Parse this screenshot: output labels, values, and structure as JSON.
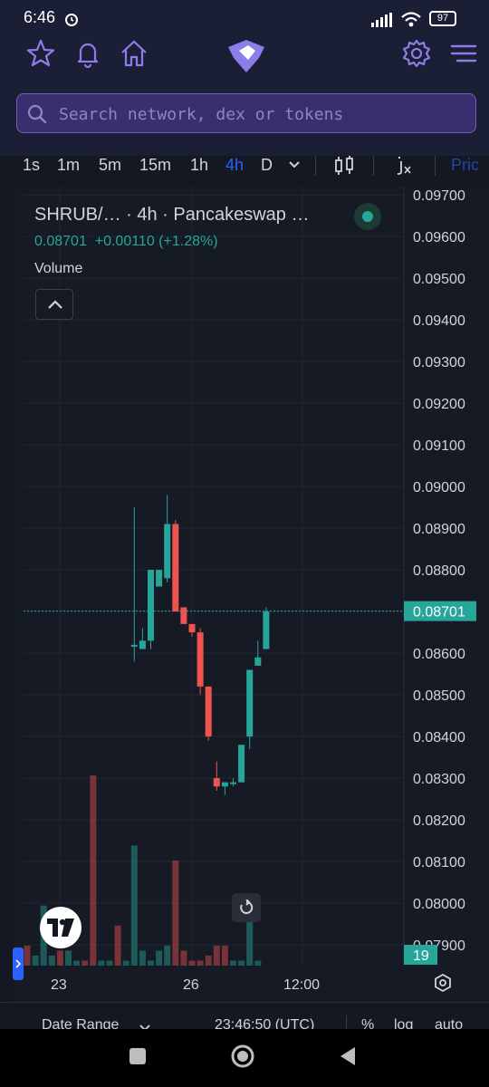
{
  "status_bar": {
    "time": "6:46",
    "battery": "97"
  },
  "nav": {
    "icons": [
      "star-icon",
      "bell-icon",
      "home-icon",
      "logo-icon",
      "gear-icon",
      "menu-icon"
    ]
  },
  "search": {
    "placeholder": "Search network, dex or tokens"
  },
  "timeframes": [
    "1s",
    "1m",
    "5m",
    "15m",
    "1h",
    "4h",
    "D"
  ],
  "active_timeframe": "4h",
  "price_tab_label": "Pric",
  "legend": {
    "title": "SHRUB/… · 4h · Pancakeswap …",
    "price": "0.08701",
    "change": "+0.00110 (+1.28%)",
    "volume_label": "Volume"
  },
  "current_price_label": "0.08701",
  "volume_badge": "19",
  "time_labels": [
    "23",
    "26",
    "12:00"
  ],
  "bottom_bar": {
    "date_range": "Date Range",
    "clock": "23:46:50 (UTC)",
    "percent": "%",
    "log": "log",
    "auto": "auto"
  },
  "colors": {
    "up": "#26a69a",
    "down": "#ef5350",
    "accent": "#2962ff",
    "nav_accent": "#8b7ee8"
  },
  "chart_data": {
    "type": "candlestick",
    "title": "SHRUB/… · 4h · Pancakeswap …",
    "ylim": [
      0.0785,
      0.0972
    ],
    "y_ticks": [
      0.097,
      0.096,
      0.095,
      0.094,
      0.093,
      0.092,
      0.091,
      0.09,
      0.089,
      0.088,
      0.087,
      0.086,
      0.085,
      0.084,
      0.083,
      0.082,
      0.081,
      0.08,
      0.079
    ],
    "y_tick_labels": [
      "0.09700",
      "0.09600",
      "0.09500",
      "0.09400",
      "0.09300",
      "0.09200",
      "0.09100",
      "0.09000",
      "0.08900",
      "0.08800",
      "0.08700",
      "0.08600",
      "0.08500",
      "0.08400",
      "0.08300",
      "0.08200",
      "0.08100",
      "0.08000",
      "0.07900"
    ],
    "candles": [
      {
        "i": 13,
        "o": 0.0862,
        "h": 0.0895,
        "l": 0.0858,
        "c": 0.0862
      },
      {
        "i": 14,
        "o": 0.0861,
        "h": 0.0866,
        "l": 0.0861,
        "c": 0.0863
      },
      {
        "i": 15,
        "o": 0.0863,
        "h": 0.088,
        "l": 0.0861,
        "c": 0.088
      },
      {
        "i": 16,
        "o": 0.0876,
        "h": 0.088,
        "l": 0.0876,
        "c": 0.088
      },
      {
        "i": 17,
        "o": 0.0878,
        "h": 0.0898,
        "l": 0.0877,
        "c": 0.0891
      },
      {
        "i": 18,
        "o": 0.0891,
        "h": 0.0892,
        "l": 0.087,
        "c": 0.087
      },
      {
        "i": 19,
        "o": 0.0871,
        "h": 0.0871,
        "l": 0.0867,
        "c": 0.0867
      },
      {
        "i": 20,
        "o": 0.0867,
        "h": 0.0867,
        "l": 0.0864,
        "c": 0.0865
      },
      {
        "i": 21,
        "o": 0.0865,
        "h": 0.0866,
        "l": 0.085,
        "c": 0.0852
      },
      {
        "i": 22,
        "o": 0.0852,
        "h": 0.0852,
        "l": 0.0839,
        "c": 0.084
      },
      {
        "i": 23,
        "o": 0.083,
        "h": 0.0834,
        "l": 0.0827,
        "c": 0.0828
      },
      {
        "i": 24,
        "o": 0.0828,
        "h": 0.0829,
        "l": 0.0826,
        "c": 0.0829
      },
      {
        "i": 25,
        "o": 0.0829,
        "h": 0.083,
        "l": 0.0828,
        "c": 0.0829
      },
      {
        "i": 26,
        "o": 0.0829,
        "h": 0.0838,
        "l": 0.0829,
        "c": 0.0838
      },
      {
        "i": 27,
        "o": 0.084,
        "h": 0.0856,
        "l": 0.0837,
        "c": 0.0856
      },
      {
        "i": 28,
        "o": 0.0857,
        "h": 0.0863,
        "l": 0.0857,
        "c": 0.0859
      },
      {
        "i": 29,
        "o": 0.0861,
        "h": 0.0871,
        "l": 0.0861,
        "c": 0.087
      }
    ],
    "red_candle_indices": [
      18,
      19,
      20,
      21,
      22,
      23
    ],
    "volumes": [
      {
        "i": 0,
        "v": 4,
        "dir": "down"
      },
      {
        "i": 1,
        "v": 2,
        "dir": "up"
      },
      {
        "i": 2,
        "v": 12,
        "dir": "up"
      },
      {
        "i": 3,
        "v": 2,
        "dir": "up"
      },
      {
        "i": 4,
        "v": 3,
        "dir": "down"
      },
      {
        "i": 5,
        "v": 3,
        "dir": "up"
      },
      {
        "i": 6,
        "v": 1,
        "dir": "up"
      },
      {
        "i": 7,
        "v": 1,
        "dir": "down"
      },
      {
        "i": 8,
        "v": 38,
        "dir": "down"
      },
      {
        "i": 9,
        "v": 1,
        "dir": "up"
      },
      {
        "i": 10,
        "v": 1,
        "dir": "up"
      },
      {
        "i": 11,
        "v": 8,
        "dir": "down"
      },
      {
        "i": 12,
        "v": 1,
        "dir": "up"
      },
      {
        "i": 13,
        "v": 24,
        "dir": "up"
      },
      {
        "i": 14,
        "v": 3,
        "dir": "up"
      },
      {
        "i": 15,
        "v": 1,
        "dir": "up"
      },
      {
        "i": 16,
        "v": 3,
        "dir": "up"
      },
      {
        "i": 17,
        "v": 4,
        "dir": "up"
      },
      {
        "i": 18,
        "v": 21,
        "dir": "down"
      },
      {
        "i": 19,
        "v": 3,
        "dir": "down"
      },
      {
        "i": 20,
        "v": 1,
        "dir": "down"
      },
      {
        "i": 21,
        "v": 1,
        "dir": "down"
      },
      {
        "i": 22,
        "v": 2,
        "dir": "down"
      },
      {
        "i": 23,
        "v": 4,
        "dir": "down"
      },
      {
        "i": 24,
        "v": 4,
        "dir": "down"
      },
      {
        "i": 25,
        "v": 1,
        "dir": "up"
      },
      {
        "i": 26,
        "v": 1,
        "dir": "up"
      },
      {
        "i": 27,
        "v": 11,
        "dir": "up"
      },
      {
        "i": 28,
        "v": 1,
        "dir": "up"
      }
    ]
  }
}
